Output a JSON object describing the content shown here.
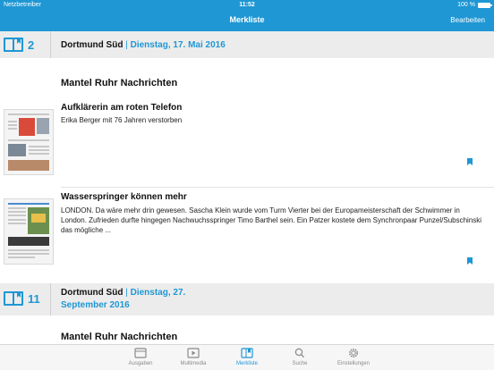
{
  "status_bar": {
    "carrier": "Netzbetreiber",
    "time": "11:52",
    "battery": "100 %"
  },
  "nav": {
    "title": "Merkliste",
    "edit_label": "Bearbeiten"
  },
  "groups": [
    {
      "pages": "2",
      "city": "Dortmund Süd",
      "separator": "|",
      "date": "Dienstag, 17. Mai 2016",
      "section": "Mantel Ruhr Nachrichten",
      "articles": [
        {
          "headline": "Aufklärerin am roten Telefon",
          "teaser": "Erika Berger mit 76 Jahren verstorben"
        },
        {
          "headline": "Wasserspringer können mehr",
          "teaser": "LONDON. Da wäre mehr drin gewesen. Sascha Klein wurde vom Turm Vierter bei der Europameisterschaft der Schwimmer in London. Zufrieden durfte hingegen Nachwuchsspringer Timo Barthel sein. Ein Patzer kostete dem Synchronpaar Punzel/Subschinski das mögliche ..."
        }
      ]
    },
    {
      "pages": "11",
      "city": "Dortmund Süd",
      "separator": "|",
      "date_line1": "Dienstag, 27.",
      "date_line2": "September 2016",
      "section": "Mantel Ruhr Nachrichten"
    }
  ],
  "tabs": [
    {
      "label": "Ausgaben",
      "icon": "newspaper-icon",
      "active": false
    },
    {
      "label": "Multimedia",
      "icon": "video-icon",
      "active": false
    },
    {
      "label": "Merkliste",
      "icon": "bookmark-book-icon",
      "active": true
    },
    {
      "label": "Suche",
      "icon": "search-icon",
      "active": false
    },
    {
      "label": "Einstellungen",
      "icon": "gear-icon",
      "active": false
    }
  ],
  "colors": {
    "accent": "#1f97d4",
    "header_bg": "#ececec",
    "tab_inactive": "#8a8a8a"
  }
}
